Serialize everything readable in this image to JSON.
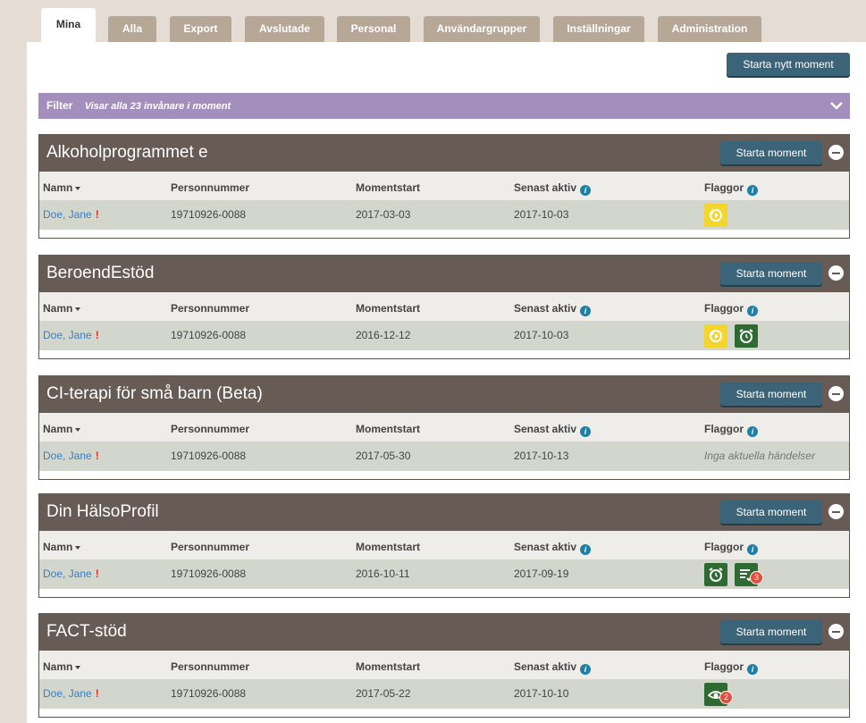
{
  "tabs": [
    "Mina",
    "Alla",
    "Export",
    "Avslutade",
    "Personal",
    "Användargrupper",
    "Inställningar",
    "Administration"
  ],
  "new_button": "Starta nytt moment",
  "filter": {
    "label": "Filter",
    "text": "Visar alla 23 invånare i moment"
  },
  "columns": {
    "name": "Namn",
    "pnr": "Personnummer",
    "start": "Momentstart",
    "last": "Senast aktiv",
    "flags": "Flaggor",
    "info_glyph": "i"
  },
  "start_button": "Starta moment",
  "alert_mark": "!",
  "moments": [
    {
      "title": "Alkoholprogrammet e",
      "name": "Doe, Jane",
      "pnr": "19710926-0088",
      "start": "2017-03-03",
      "last": "2017-10-03",
      "flags": [
        {
          "icon": "replay-icon",
          "color": "#f3d52b"
        }
      ],
      "no_events": ""
    },
    {
      "title": "BeroendEstöd",
      "name": "Doe, Jane",
      "pnr": "19710926-0088",
      "start": "2016-12-12",
      "last": "2017-10-03",
      "flags": [
        {
          "icon": "replay-icon",
          "color": "#f3d52b"
        },
        {
          "icon": "alarm-clock-icon",
          "color": "#2e6b33"
        }
      ],
      "no_events": ""
    },
    {
      "title": "CI-terapi för små barn (Beta)",
      "name": "Doe, Jane",
      "pnr": "19710926-0088",
      "start": "2017-05-30",
      "last": "2017-10-13",
      "flags": [],
      "no_events": "Inga aktuella händelser"
    },
    {
      "title": "Din HälsoProfil",
      "name": "Doe, Jane",
      "pnr": "19710926-0088",
      "start": "2016-10-11",
      "last": "2017-09-19",
      "flags": [
        {
          "icon": "alarm-clock-icon",
          "color": "#2e6b33"
        },
        {
          "icon": "task-list-icon",
          "color": "#2e6b33",
          "badge": "3"
        }
      ],
      "no_events": ""
    },
    {
      "title": "FACT-stöd",
      "name": "Doe, Jane",
      "pnr": "19710926-0088",
      "start": "2017-05-22",
      "last": "2017-10-10",
      "flags": [
        {
          "icon": "eye-icon",
          "color": "#2e6b33",
          "badge": "2"
        }
      ],
      "no_events": ""
    }
  ]
}
